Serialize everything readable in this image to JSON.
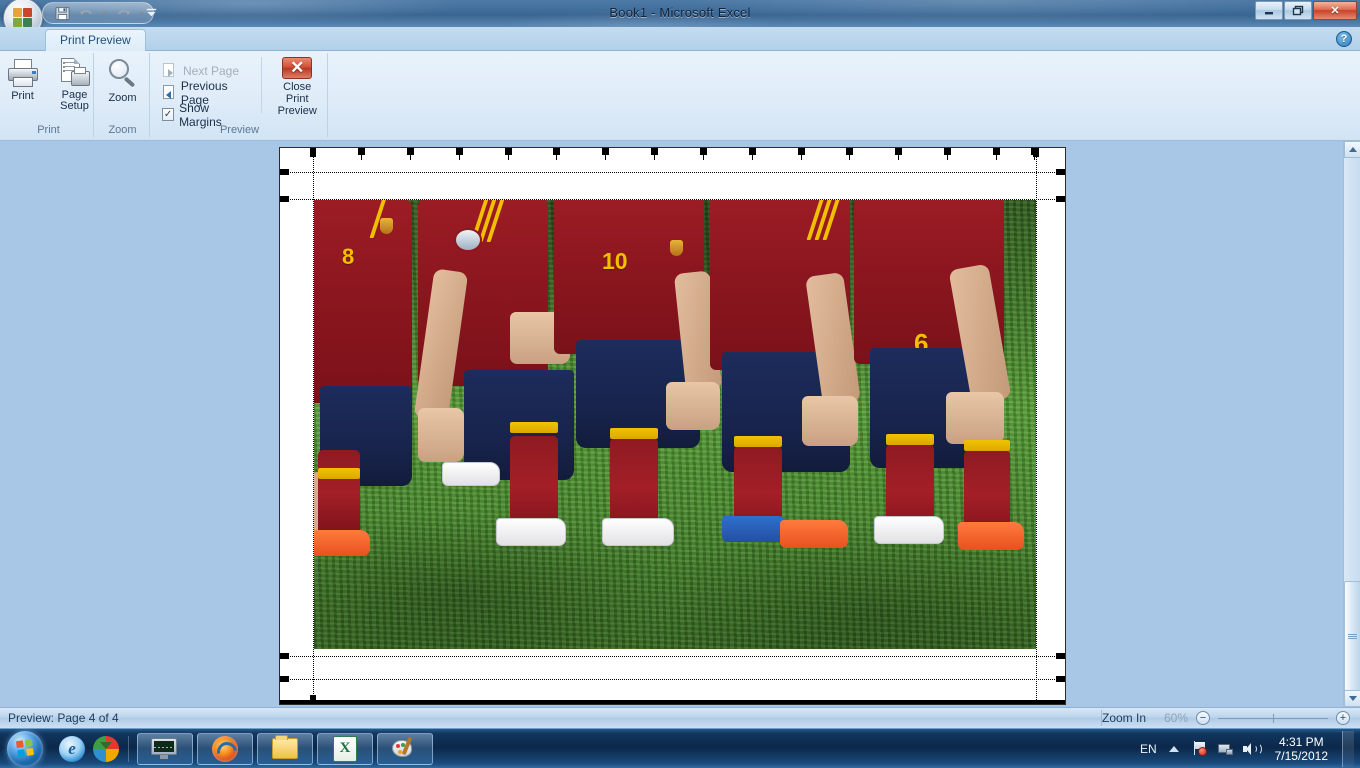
{
  "window": {
    "title": "Book1 - Microsoft Excel",
    "minimize_label": "–",
    "restore_label": "❐",
    "close_label": "✕",
    "help_label": "?"
  },
  "quick_access": {
    "save_label": "💾",
    "undo_label": "↶",
    "redo_label": "↷",
    "undo_caret": "▾",
    "redo_caret": "▾",
    "customize_label": "▼"
  },
  "ribbon": {
    "tabs": [
      {
        "label": "Print Preview",
        "active": true
      }
    ],
    "groups": [
      {
        "name": "print",
        "label": "Print",
        "items": [
          {
            "name": "print-button",
            "label": "Print",
            "icon": "printer-icon",
            "enabled": true
          },
          {
            "name": "page-setup-button",
            "label": "Page\nSetup",
            "label_line1": "Page",
            "label_line2": "Setup",
            "icon": "page-setup-icon",
            "enabled": true
          }
        ]
      },
      {
        "name": "zoom",
        "label": "Zoom",
        "items": [
          {
            "name": "zoom-button",
            "label": "Zoom",
            "icon": "magnifier-icon",
            "enabled": true
          }
        ]
      },
      {
        "name": "preview",
        "label": "Preview",
        "items": [
          {
            "name": "next-page-button",
            "label": "Next Page",
            "icon": "next-page-icon",
            "enabled": false
          },
          {
            "name": "previous-page-button",
            "label": "Previous Page",
            "icon": "previous-page-icon",
            "enabled": true
          },
          {
            "name": "show-margins-checkbox",
            "label": "Show Margins",
            "checked": true,
            "check_glyph": "✓"
          },
          {
            "name": "close-print-preview-button",
            "label_line1": "Close Print",
            "label_line2": "Preview",
            "icon": "close-red-icon",
            "icon_glyph": "✕",
            "enabled": true
          }
        ]
      }
    ]
  },
  "preview": {
    "page_number": 4,
    "page_count": 4,
    "show_margins": true,
    "column_break_count": 15,
    "photo": {
      "description": "Spanish national football team players standing in a line on grass, hands on knees",
      "players": [
        {
          "shirt_number": "8",
          "shirt_color": "#8e1720",
          "shorts_color": "#18244d",
          "sock_color": "#a31f27"
        },
        {
          "shirt_number": "10",
          "shirt_color": "#8e1720",
          "shorts_color": "#18244d",
          "sock_color": "#a31f27"
        },
        {
          "shirt_number": "6",
          "shirt_color": "#8e1720",
          "shorts_color": "#18244d",
          "sock_color": "#a31f27"
        }
      ],
      "grass_color": "#4a8e2d",
      "jersey_color": "#8e1720",
      "shorts_color": "#18244d",
      "accent_color": "#f0c000"
    }
  },
  "status_bar": {
    "left_text": "Preview: Page 4 of 4",
    "zoom_label": "Zoom In",
    "zoom_percent": "60%",
    "zoom_out_glyph": "−",
    "zoom_in_glyph": "+"
  },
  "scrollbar": {
    "up_arrow": "▲",
    "down_arrow": "▼"
  },
  "taskbar": {
    "start_label": "Start",
    "quick_launch": [
      {
        "name": "internet-explorer-icon",
        "label": "e"
      },
      {
        "name": "internet-download-manager-icon",
        "label": "IDM"
      }
    ],
    "tasks": [
      {
        "name": "taskbar-item-system-monitor",
        "label": "System Monitor"
      },
      {
        "name": "taskbar-item-firefox",
        "label": "Mozilla Firefox"
      },
      {
        "name": "taskbar-item-windows-explorer",
        "label": "Windows Explorer"
      },
      {
        "name": "taskbar-item-excel",
        "label": "Microsoft Excel",
        "glyph": "X"
      },
      {
        "name": "taskbar-item-paint",
        "label": "Paint"
      }
    ],
    "tray": {
      "language": "EN",
      "show_hidden_label": "▲",
      "icons": [
        {
          "name": "action-center-flag-icon"
        },
        {
          "name": "network-icon"
        },
        {
          "name": "volume-icon"
        }
      ],
      "time": "4:31 PM",
      "date": "7/15/2012"
    }
  }
}
